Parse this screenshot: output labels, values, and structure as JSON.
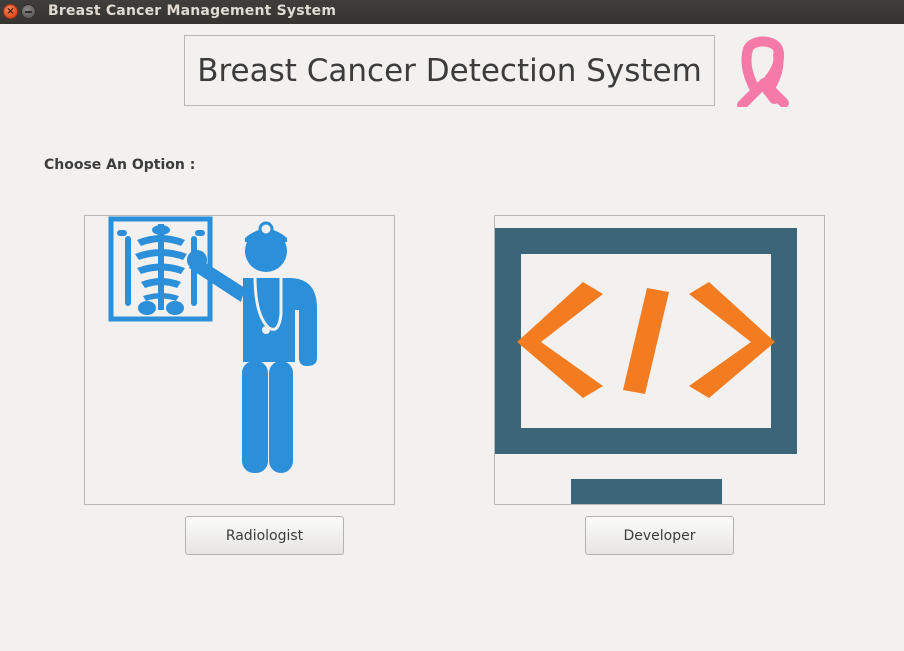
{
  "window": {
    "title": "Breast Cancer Management System"
  },
  "header": {
    "title": "Breast Cancer Detection System"
  },
  "prompt": {
    "label": "Choose An Option :"
  },
  "options": [
    {
      "label": "Radiologist",
      "icon": "radiologist-xray-icon"
    },
    {
      "label": "Developer",
      "icon": "code-monitor-icon"
    }
  ],
  "colors": {
    "ribbon": "#f57aa8",
    "radiologist_blue": "#2b8fd9",
    "monitor_slate": "#3b6679",
    "code_orange": "#f37b20"
  }
}
